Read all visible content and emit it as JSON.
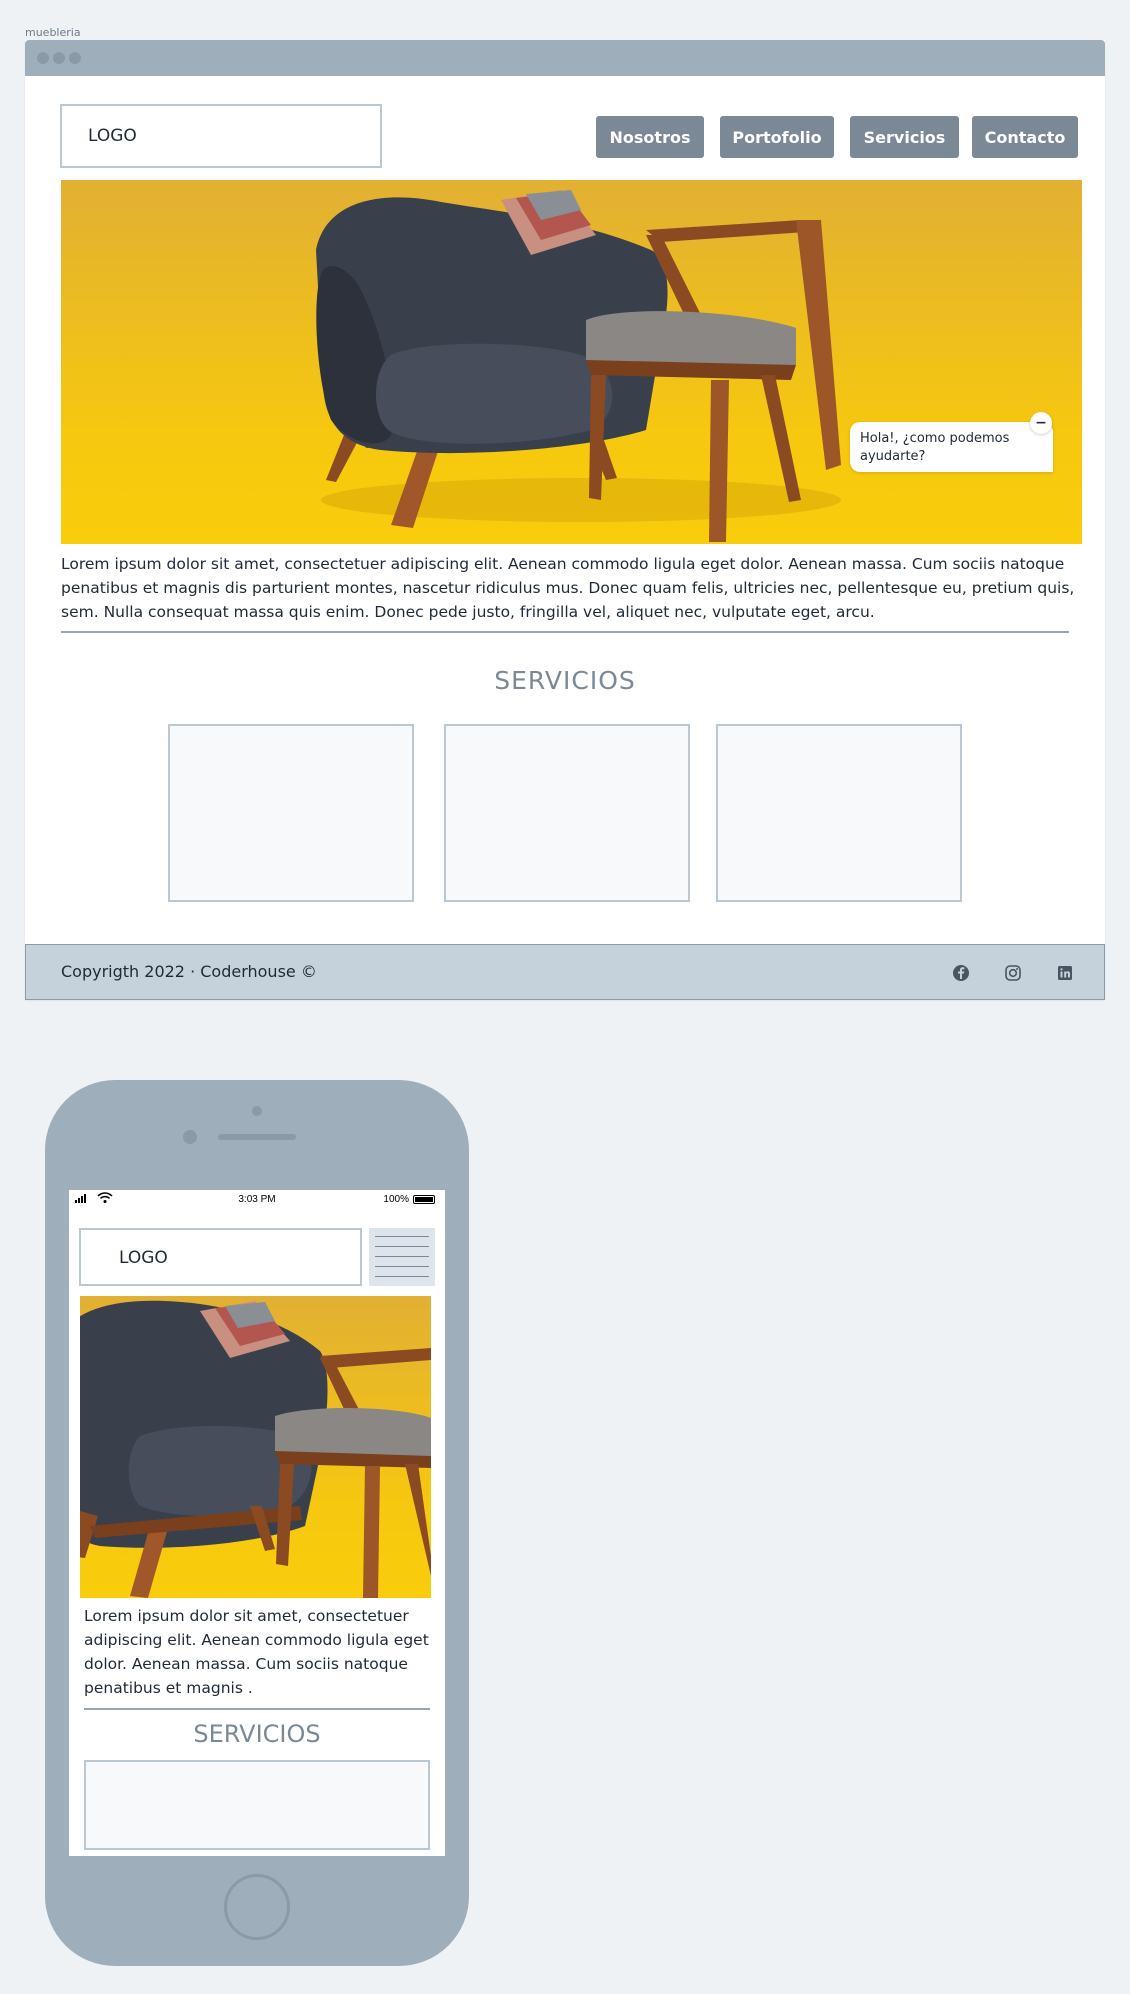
{
  "page": {
    "frame_label": "muebleria"
  },
  "desktop": {
    "logo": "LOGO",
    "nav": [
      "Nosotros",
      "Portofolio",
      "Servicios",
      "Contacto"
    ],
    "hero_alt": "armchair-and-chair-photo",
    "chat": {
      "message": "Hola!, ¿como podemos ayudarte?",
      "close": "−"
    },
    "intro": "Lorem ipsum dolor sit amet, consectetuer adipiscing elit. Aenean commodo  ligula eget dolor. Aenean massa. Cum sociis natoque penatibus et magnis  dis parturient montes, nascetur ridiculus mus. Donec quam felis,  ultricies nec, pellentesque eu, pretium quis, sem. Nulla consequat massa  quis enim. Donec pede justo, fringilla vel, aliquet nec, vulputate  eget, arcu.",
    "servicios_title": "SERVICIOS",
    "footer": {
      "copyright": "Copyrigth 2022 · Coderhouse ©",
      "social_icons": [
        "facebook-icon",
        "instagram-icon",
        "linkedin-icon"
      ]
    }
  },
  "mobile": {
    "status": {
      "time": "3:03 PM",
      "battery": "100%"
    },
    "logo": "LOGO",
    "intro": "Lorem ipsum dolor sit amet, consectetuer adipiscing elit. Aenean commodo  ligula eget dolor. Aenean massa. Cum sociis natoque penatibus et magnis .",
    "servicios_title": "SERVICIOS"
  },
  "colors": {
    "browser_bar": "#9eaebb",
    "nav_button": "#7b8997",
    "card_border": "#b9c8d3",
    "footer_bg": "#c5d1db",
    "hero_yellow": "#f6c80f"
  }
}
